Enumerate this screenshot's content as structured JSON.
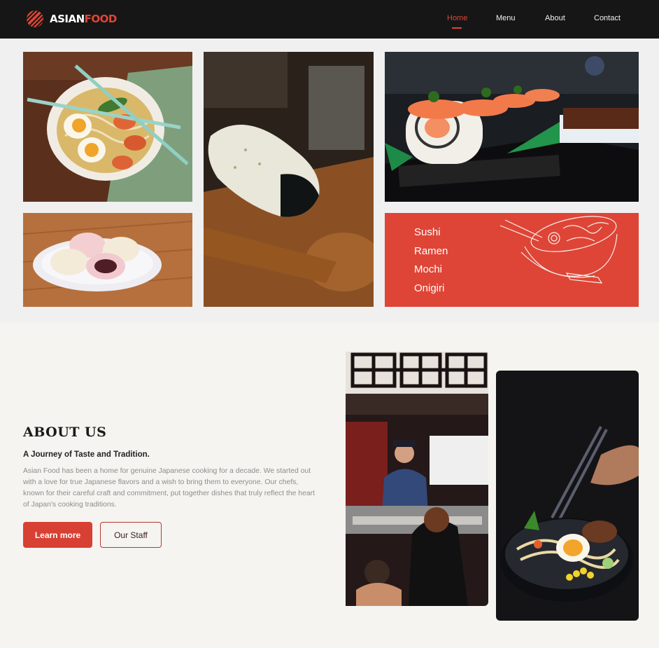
{
  "brand": {
    "name_part1": "ASIAN",
    "name_part2": "FOOD",
    "accent": "#de4537",
    "nav_bg": "#161616",
    "logo_icon": "striped-circle-icon"
  },
  "nav": {
    "items": [
      {
        "label": "Home",
        "active": true
      },
      {
        "label": "Menu"
      },
      {
        "label": "About"
      },
      {
        "label": "Contact"
      }
    ]
  },
  "gallery": {
    "photos": [
      "ramen-photo",
      "onigiri-photo",
      "sushi-photo",
      "mochi-photo",
      "chef-photo",
      "ramen-bowl-photo"
    ],
    "menu_panel": {
      "items": [
        "Sushi",
        "Ramen",
        "Mochi",
        "Onigiri"
      ],
      "background": "#de4537",
      "illustration": "noodle-bowl-line-art"
    }
  },
  "about": {
    "title": "ABOUT US",
    "subtitle": "A Journey of Taste and Tradition.",
    "body": "Asian Food has been a home for genuine Japanese cooking for a decade. We started out with a love for true Japanese flavors and a wish to bring them to everyone. Our chefs, known for their careful craft and commitment, put together dishes that truly reflect the heart of Japan's cooking traditions.",
    "primary_button": "Learn more",
    "secondary_button": "Our Staff"
  }
}
